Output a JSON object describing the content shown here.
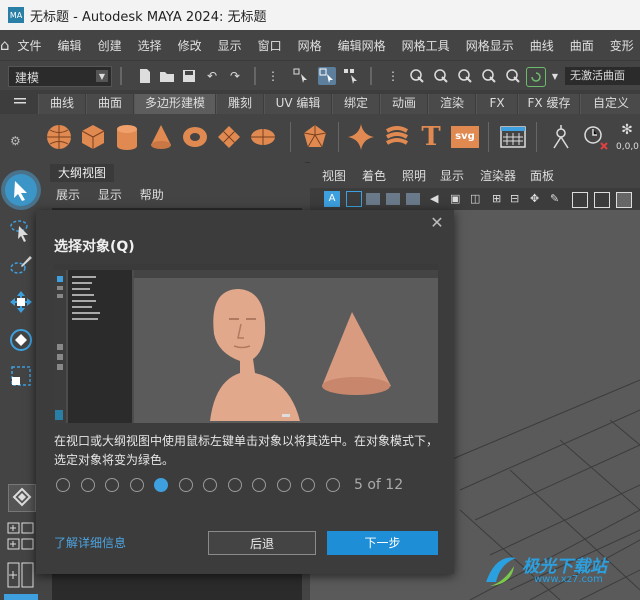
{
  "window": {
    "title": "无标题 - Autodesk MAYA 2024: 无标题",
    "app_icon_text": "MA"
  },
  "menubar": {
    "items": [
      "文件",
      "编辑",
      "创建",
      "选择",
      "修改",
      "显示",
      "窗口",
      "网格",
      "编辑网格",
      "网格工具",
      "网格显示",
      "曲线",
      "曲面",
      "变形"
    ]
  },
  "statusline": {
    "mode": "建模",
    "no_active_surface": "无激活曲面"
  },
  "shelf": {
    "tabs": [
      "曲线",
      "曲面",
      "多边形建模",
      "雕刻",
      "UV 编辑",
      "绑定",
      "动画",
      "渲染",
      "FX",
      "FX 缓存",
      "自定义"
    ],
    "active_tab": "多边形建模",
    "items": [
      "sphere-icon",
      "cube-icon",
      "cylinder-icon",
      "cone-icon",
      "torus-icon",
      "plane-icon",
      "disc-icon",
      "platonic-icon",
      "super-shape-icon",
      "helix-icon",
      "type-icon",
      "svg-icon",
      "grid-icon",
      "measure-icon",
      "timer-icon",
      "snowflake-icon"
    ],
    "svg_label": "svg",
    "type_label": "T",
    "snow_label": "0,0,0"
  },
  "outliner": {
    "title": "大纲视图",
    "menus": [
      "展示",
      "显示",
      "帮助"
    ]
  },
  "viewport": {
    "menus": [
      "视图",
      "着色",
      "照明",
      "显示",
      "渲染器",
      "面板"
    ]
  },
  "dialog": {
    "title": "选择对象(Q)",
    "description": "在视口或大纲视图中使用鼠标左键单击对象以将其选中。在对象模式下，选定对象将变为绿色。",
    "total_steps": 12,
    "current_step": 5,
    "counter": "5 of 12",
    "learn_more": "了解详细信息",
    "back": "后退",
    "next": "下一步"
  },
  "watermark": {
    "text": "极光下载站",
    "url": "www.xz7.com"
  },
  "colors": {
    "accent": "#1e8ed6",
    "shelf_icon": "#e08a52",
    "active_tool": "#3b95c7"
  }
}
